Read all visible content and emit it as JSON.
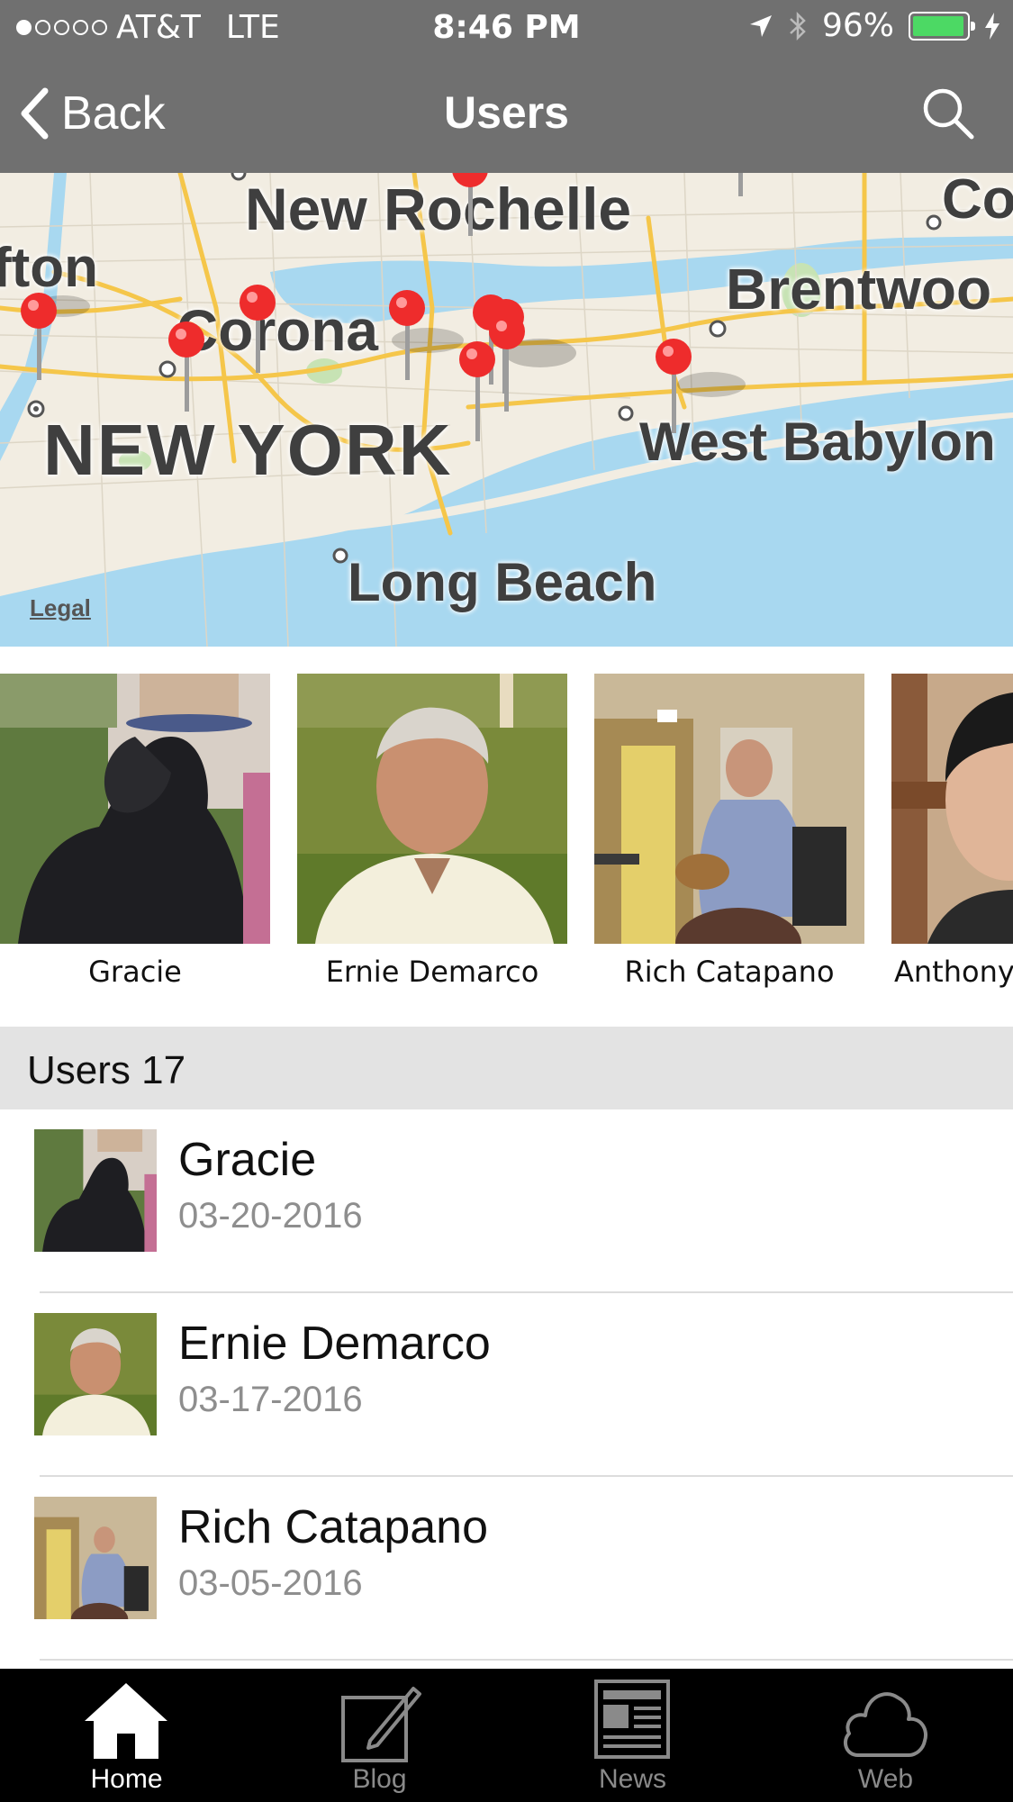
{
  "status_bar": {
    "carrier": "AT&T",
    "network": "LTE",
    "time": "8:46 PM",
    "battery": "96%",
    "battery_level": 0.96
  },
  "nav": {
    "back_label": "Back",
    "title": "Users"
  },
  "map": {
    "labels": [
      "New Rochelle",
      "fton",
      "Co",
      "Brentwoo",
      "Corona",
      "NEW YORK",
      "West Babylon",
      "Long Beach"
    ],
    "legal": "Legal"
  },
  "featured_users": [
    {
      "name": "Gracie"
    },
    {
      "name": "Ernie Demarco"
    },
    {
      "name": "Rich Catapano"
    },
    {
      "name": "Anthony"
    }
  ],
  "section": {
    "title": "Users 17"
  },
  "users": [
    {
      "name": "Gracie",
      "date": "03-20-2016"
    },
    {
      "name": "Ernie Demarco",
      "date": "03-17-2016"
    },
    {
      "name": "Rich Catapano",
      "date": "03-05-2016"
    }
  ],
  "tabs": [
    {
      "label": "Home",
      "icon": "home-icon",
      "active": true
    },
    {
      "label": "Blog",
      "icon": "blog-icon",
      "active": false
    },
    {
      "label": "News",
      "icon": "news-icon",
      "active": false
    },
    {
      "label": "Web",
      "icon": "web-icon",
      "active": false
    }
  ],
  "colors": {
    "bar_gray": "#707070",
    "water": "#a8d8f0",
    "pin_red": "#ee2c2c",
    "tab_active": "#ffffff",
    "tab_inactive": "#8a8a8a"
  }
}
